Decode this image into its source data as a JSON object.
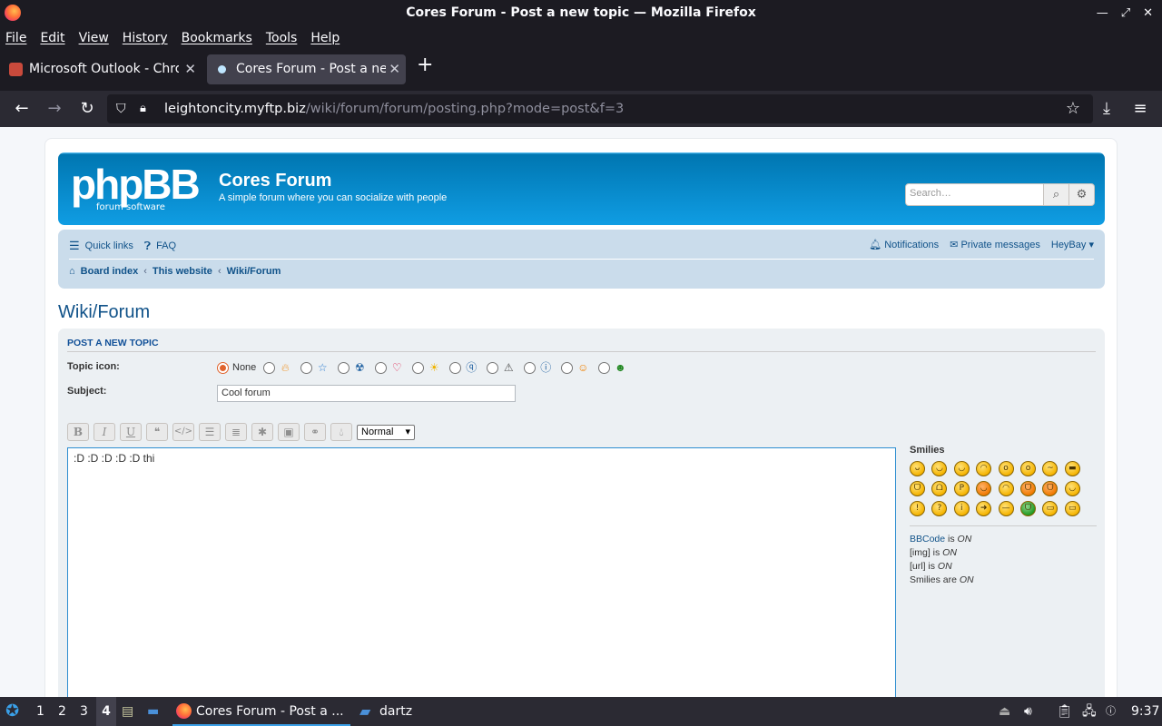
{
  "window": {
    "title": "Cores Forum - Post a new topic — Mozilla Firefox"
  },
  "menu": [
    "File",
    "Edit",
    "View",
    "History",
    "Bookmarks",
    "Tools",
    "Help"
  ],
  "tabs": [
    {
      "label": "Microsoft Outlook - Chrome"
    },
    {
      "label": "Cores Forum - Post a new topic"
    }
  ],
  "url": {
    "host": "leightoncity.myftp.biz",
    "path": "/wiki/forum/forum/posting.php?mode=post&f=3"
  },
  "site": {
    "logo": "phpBB",
    "logo_sub": "forum  software",
    "title": "Cores Forum",
    "description": "A simple forum where you can socialize with people",
    "search_placeholder": "Search…"
  },
  "nav": {
    "quick_links": "Quick links",
    "faq": "FAQ",
    "notifications": "Notifications",
    "private_messages": "Private messages",
    "user": "HeyBay"
  },
  "breadcrumbs": [
    "Board index",
    "This website",
    "Wiki/Forum"
  ],
  "page_title": "Wiki/Forum",
  "form": {
    "heading": "POST A NEW TOPIC",
    "topic_icon_label": "Topic icon:",
    "none_label": "None",
    "subject_label": "Subject:",
    "subject_value": "Cool forum",
    "font_size": "Normal",
    "message": ":D  :D  :D  :D  :D thi"
  },
  "smilies": {
    "heading": "Smilies"
  },
  "bbinfo": {
    "bbcode": "BBCode",
    "bbcode_rest": " is ",
    "bbcode_state": "ON",
    "img": "[img] is ",
    "img_state": "ON",
    "url": "[url] is ",
    "url_state": "ON",
    "smilies": "Smilies are ",
    "smilies_state": "ON"
  },
  "taskbar": {
    "workspaces": [
      "1",
      "2",
      "3",
      "4"
    ],
    "active_window": "Cores Forum - Post a ...",
    "folder": "dartz",
    "clock": "9:37"
  }
}
